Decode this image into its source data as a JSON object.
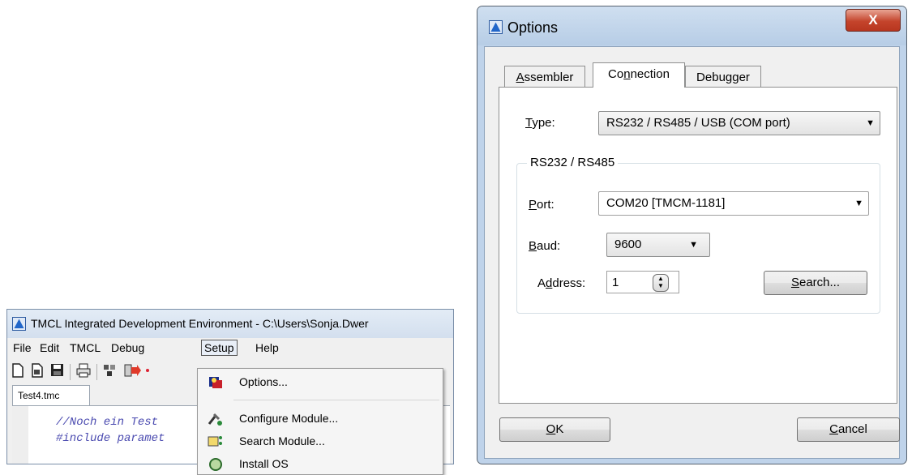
{
  "ide": {
    "title": "TMCL Integrated Development Environment - C:\\Users\\Sonja.Dwer",
    "menu": [
      {
        "label": "File"
      },
      {
        "label": "Edit"
      },
      {
        "label": "TMCL"
      },
      {
        "label": "Debug"
      },
      {
        "label": "Setup"
      },
      {
        "label": "Help"
      }
    ],
    "active_menu": "Setup",
    "file_tab": "Test4.tmc",
    "code_lines": [
      "//Noch ein Test",
      "#include paramet"
    ],
    "toolbar_icons": [
      "new-file-icon",
      "open-file-icon",
      "save-icon",
      "print-icon",
      "assemble-icon",
      "download-icon"
    ],
    "setup_menu": [
      {
        "label": "Options...",
        "icon": "options-icon"
      },
      {
        "label": "Configure Module...",
        "icon": "configure-module-icon"
      },
      {
        "label": "Search Module...",
        "icon": "search-module-icon"
      },
      {
        "label": "Install OS",
        "icon": "install-os-icon"
      }
    ]
  },
  "dialog": {
    "title": "Options",
    "close_glyph": "X",
    "tabs": [
      {
        "label_pre": "",
        "label_mnemonic": "A",
        "label_post": "ssembler"
      },
      {
        "label_pre": "Co",
        "label_mnemonic": "n",
        "label_post": "nection"
      },
      {
        "label_pre": "Debugger",
        "label_mnemonic": "",
        "label_post": ""
      }
    ],
    "selected_tab": "Connection",
    "type": {
      "label_mnemonic": "T",
      "label_post": "ype:",
      "value": "RS232 / RS485 / USB (COM port)"
    },
    "group_title": "RS232 / RS485",
    "port": {
      "label_mnemonic": "P",
      "label_post": "ort:",
      "value": "COM20  [TMCM-1181]"
    },
    "baud": {
      "label_mnemonic": "B",
      "label_post": "aud:",
      "value": "9600"
    },
    "address": {
      "label_pre": "A",
      "label_mnemonic": "d",
      "label_post": "dress:",
      "value": "1"
    },
    "search_button": {
      "label_mnemonic": "S",
      "label_post": "earch..."
    },
    "ok_button": {
      "label_mnemonic": "O",
      "label_post": "K"
    },
    "cancel_button": {
      "label_mnemonic": "C",
      "label_post": "ancel"
    }
  }
}
